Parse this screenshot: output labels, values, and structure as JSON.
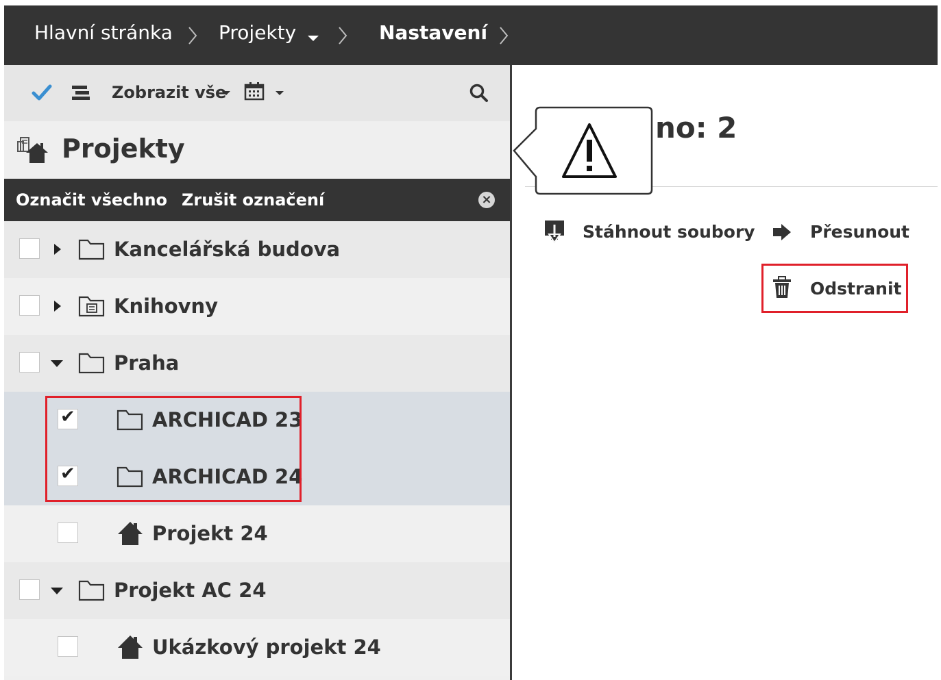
{
  "breadcrumb": {
    "items": [
      {
        "label": "Hlavní stránka"
      },
      {
        "label": "Projekty"
      },
      {
        "label": "Nastavení"
      }
    ]
  },
  "toolbar": {
    "view_label": "Zobrazit vše"
  },
  "panel": {
    "title": "Projekty"
  },
  "selection": {
    "select_all": "Označit všechno",
    "clear": "Zrušit označení"
  },
  "tree": {
    "items": [
      {
        "label": "Kancelářská budova",
        "checked": false
      },
      {
        "label": "Knihovny",
        "checked": false
      },
      {
        "label": "Praha",
        "checked": false
      },
      {
        "label": "ARCHICAD 23",
        "checked": true
      },
      {
        "label": "ARCHICAD 24",
        "checked": true
      },
      {
        "label": "Projekt 24",
        "checked": false
      },
      {
        "label": "Projekt AC 24",
        "checked": false
      },
      {
        "label": "Ukázkový projekt 24",
        "checked": false
      }
    ]
  },
  "details": {
    "count_text": "no: 2"
  },
  "actions": {
    "download": "Stáhnout soubory",
    "move": "Přesunout",
    "delete": "Odstranit"
  },
  "colors": {
    "topbar": "#343434",
    "highlight": "#e0202a",
    "check_accent": "#3a8fd1",
    "selected_row": "#d8dde3"
  }
}
